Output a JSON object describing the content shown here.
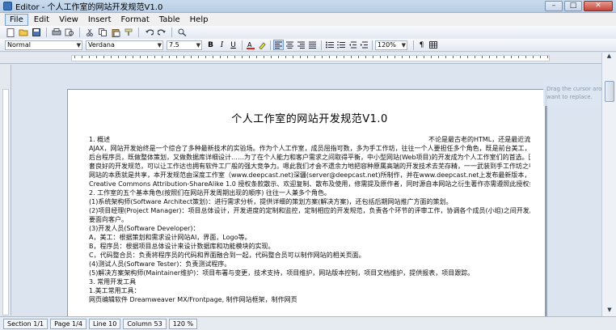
{
  "window": {
    "title": "Editor - 个人工作室的网站开发规范V1.0",
    "min": "–",
    "max": "□",
    "close": "✕"
  },
  "menu": [
    "File",
    "Edit",
    "View",
    "Insert",
    "Format",
    "Table",
    "Help"
  ],
  "format_bar": {
    "style": "Normal",
    "font": "Verdana",
    "size": "7.5",
    "zoom": "120%",
    "bold": "B",
    "italic": "I",
    "underline": "U",
    "pilcrow": "¶"
  },
  "hint": {
    "line1": "Drag the cursor around to",
    "line2": "want to replace."
  },
  "document": {
    "title": "个人工作室的网站开发规范V1.0",
    "lines": [
      {
        "text": "1. 概述",
        "right": "不论是最古老的HTML，还是最近流行的"
      },
      {
        "text": "AJAX，网站开发始终是一个综合了多种最新技术的实验场。作为个人工作室，成员屈指可数，多为手工作坊，往往一个人要担任多个角色，既是前台美工，又是"
      },
      {
        "text": "后台程序员，既做整体策划，又做数据库详细设计……为了在个人能力和客户需求之间取得平衡，中小型网站(Web项目)的开发成为个人工作室们的首选。因为一"
      },
      {
        "text": "套良好的开发规范，可以让工作达也拥有软件工厂般的强大竞争力。嗯此我们才会不遗余力地把容种原属高端的开发技术去芜存精，一一武装到手工作坊之中。"
      },
      {
        "text": "网站的本质就是共享，本开发规范由深度工作室（www.deepcast.net)深疆(server@deepcast.net)所制作，并在www.deepcast.net上发布最新版本，依照"
      },
      {
        "text": "Creative Commons Attribution-ShareAlike 1.0 授权条款散示、欢迎复制、散布及使用，修需提及原作者，同时源自本网站之衍生著作亦需遵照此授权条款。"
      },
      {
        "text": "2. 工作室的五个基本角色(按照们在网站开发周期出现的顺序) 往往一人兼多个角色。"
      },
      {
        "text": "(1)系统架构师(Software Architect策划)：进行需求分析，提供详细的策划方案(解决方案)，还包括后期网站推广方面的策划。"
      },
      {
        "text": "(2)项目经理(Project Manager)：项目总体设计，开发进度的定制和监控，定制相应的开发规范，负责各个环节的评审工作，协调各个成员(小组)之间开发。还"
      },
      {
        "text": "要面向客户。"
      },
      {
        "text": "(3)开发人员(Software Developer)："
      },
      {
        "text": "A，美工：根据策划和需求设计网站AI，界面，Logo等。"
      },
      {
        "text": "B，程序员：根据项目总体设计来设计数据库和功能模块的实现。"
      },
      {
        "text": "C，代码整合员：负责将程序员的代码和界面融合到一起，代码整合员可以制作网站的相关页面。"
      },
      {
        "text": "(4)测试人员(Software Tester)：负责测试程序。"
      },
      {
        "text": "(5)解决方案架构师(Maintainer维护)：项目布署与变更，技术支持，项目维护，网站版本控制，项目文档维护，提供报表，项目跟踪。"
      },
      {
        "text": "3. 常用开发工具"
      },
      {
        "text": "1.美工常用工具："
      },
      {
        "text": "网页编辑软件 Dreamweaver MX/Frontpage, 制作网站框架，制作网页"
      }
    ]
  },
  "status": [
    "Section 1/1",
    "Page 1/4",
    "Line 10",
    "Column 53",
    "120 %"
  ]
}
